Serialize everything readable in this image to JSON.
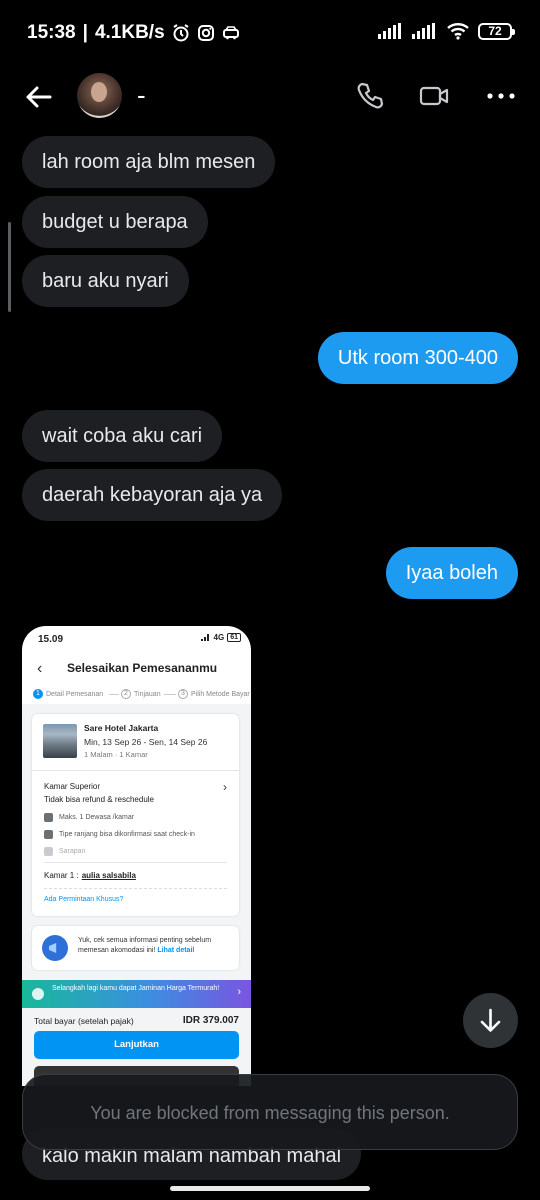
{
  "status_bar": {
    "time": "15:38",
    "speed": "4.1KB/s",
    "battery": "72"
  },
  "header": {
    "contact_name": "-"
  },
  "messages": [
    {
      "text": "lah room aja blm mesen",
      "direction": "received"
    },
    {
      "text": "budget u berapa",
      "direction": "received"
    },
    {
      "text": "baru aku nyari",
      "direction": "received"
    },
    {
      "text": "Utk room 300-400",
      "direction": "sent"
    },
    {
      "text": "wait coba aku cari",
      "direction": "received"
    },
    {
      "text": "daerah kebayoran aja ya",
      "direction": "received"
    },
    {
      "text": "Iyaa boleh",
      "direction": "sent"
    },
    {
      "text": "kalo makin malam nambah mahal",
      "direction": "received"
    }
  ],
  "attachment": {
    "status_time": "15.09",
    "network": "4G",
    "battery": "61",
    "page_title": "Selesaikan Pemesananmu",
    "steps": [
      {
        "num": "1",
        "label": "Detail Pemesanan"
      },
      {
        "num": "2",
        "label": "Tinjauan"
      },
      {
        "num": "3",
        "label": "Pilih Metode Bayar"
      }
    ],
    "hotel_name": "Sare Hotel Jakarta",
    "dates": "Min, 13 Sep 26 - Sen, 14 Sep 26",
    "nights": "1 Malam · 1 Kamar",
    "room_type": "Kamar Superior",
    "room_policy": "Tidak bisa refund & reschedule",
    "features": [
      "Maks. 1 Dewasa /kamar",
      "Tipe ranjang bisa dikonfirmasi saat check-in",
      "Sarapan"
    ],
    "guest_label": "Kamar 1 :",
    "guest_name": "aulia salsabila",
    "special_request": "Ada Permintaan Khusus?",
    "info_text": "Yuk, cek semua informasi penting sebelum memesan akomodasi ini!",
    "info_link": "Lihat detail",
    "promo_text": "Selangkah lagi kamu dapat Jaminan Harga Termurah!",
    "total_label": "Total bayar (setelah pajak)",
    "total_value": "IDR 379.007",
    "cta_label": "Lanjutkan"
  },
  "blocked_notice": "You are blocked from messaging this person.",
  "colors": {
    "sent_bubble": "#1d9bf0",
    "received_bubble": "#1d1f22",
    "background": "#000000",
    "app_accent": "#0194f3"
  }
}
